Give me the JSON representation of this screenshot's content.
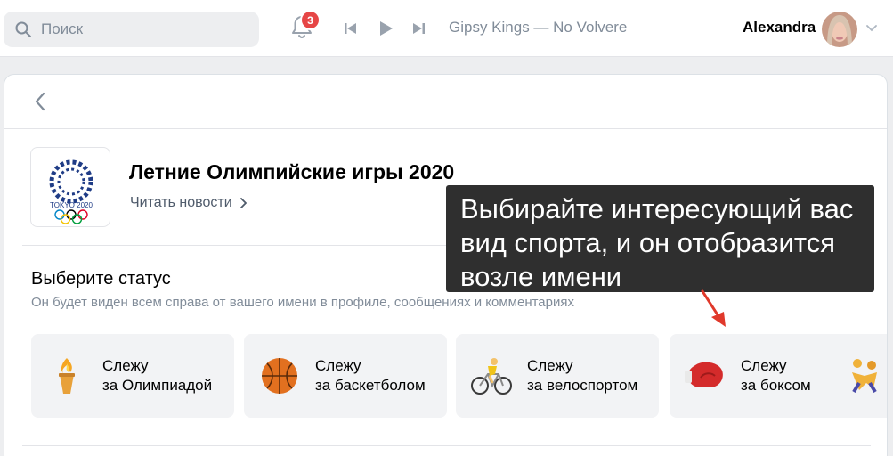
{
  "header": {
    "search_placeholder": "Поиск",
    "notification_count": "3",
    "now_playing": "Gipsy Kings — No Volvere",
    "user_name": "Alexandra"
  },
  "page": {
    "title": "Летние Олимпийские игры 2020",
    "read_news": "Читать новости",
    "logo_text": "TOKYO 2020",
    "status_heading": "Выберите статус",
    "status_subtitle": "Он будет виден всем справа от вашего имени в профиле, сообщениях и комментариях",
    "status_options": [
      {
        "line1": "Слежу",
        "line2": "за Олимпиадой",
        "icon": "torch-icon"
      },
      {
        "line1": "Слежу",
        "line2": "за баскетболом",
        "icon": "basketball-icon"
      },
      {
        "line1": "Слежу",
        "line2": "за велоспортом",
        "icon": "cyclist-icon"
      },
      {
        "line1": "Слежу",
        "line2": "за боксом",
        "icon": "boxing-glove-icon"
      }
    ]
  },
  "annotation": {
    "tooltip_text": "Выбирайте интересующий вас вид спорта, и он отобразится возле имени"
  },
  "colors": {
    "accent_badge": "#e64646",
    "tooltip_bg": "#2f2f2f",
    "arrow": "#e0392b",
    "card_bg": "#f2f3f5"
  }
}
